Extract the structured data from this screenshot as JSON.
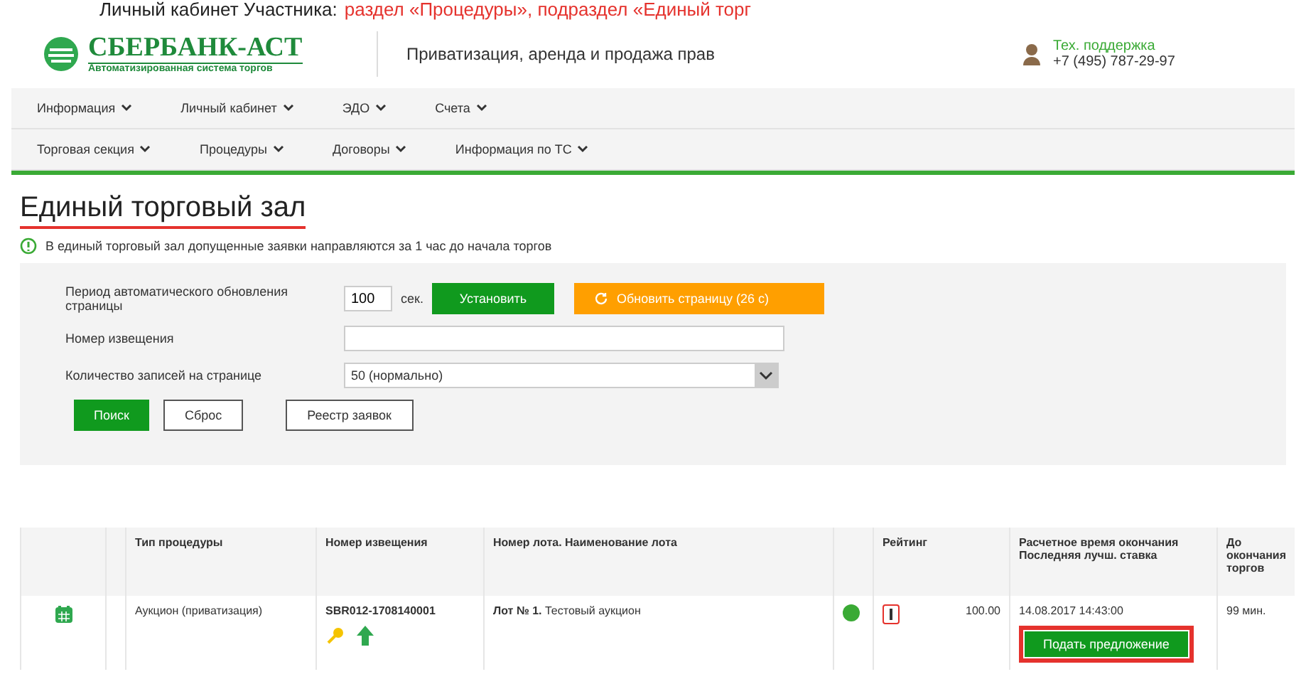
{
  "caption": {
    "prefix": "Личный кабинет Участника:",
    "highlight": "раздел «Процедуры», подраздел «Единый торг"
  },
  "header": {
    "logo_title": "СБЕРБАНК-АСТ",
    "logo_subtitle": "Автоматизированная система торгов",
    "tagline": "Приватизация, аренда и продажа прав",
    "support_label": "Тех. поддержка",
    "support_phone": "+7 (495) 787-29-97"
  },
  "nav_rows": [
    [
      "Информация",
      "Личный кабинет",
      "ЭДО",
      "Счета"
    ],
    [
      "Торговая секция",
      "Процедуры",
      "Договоры",
      "Информация по ТС"
    ]
  ],
  "page_title": "Единый торговый зал",
  "notice": "В единый торговый зал допущенные заявки направляются за 1 час до начала торгов",
  "filters": {
    "refresh_label": "Период автоматического обновления страницы",
    "refresh_value": "100",
    "refresh_unit": "сек.",
    "set_button": "Установить",
    "reload_button": "Обновить страницу (26 с)",
    "notice_label": "Номер извещения",
    "page_size_label": "Количество записей на странице",
    "page_size_value": "50 (нормально)",
    "buttons": [
      "Поиск",
      "Сброс",
      "Реестр заявок"
    ]
  },
  "table": {
    "columns": [
      "",
      "",
      "Тип процедуры",
      "Номер извещения",
      "Номер лота. Наименование лота",
      "",
      "Рейтинг",
      "Расчетное время окончания Последняя лучш. ставка",
      "До окончания торгов"
    ],
    "rows": [
      {
        "type": "Аукцион (приватизация)",
        "notice": "SBR012-1708140001",
        "lot_bold": "Лот № 1.",
        "lot_name": "Тестовый аукцион",
        "color": "#3aaa35",
        "rating": "100.00",
        "end_time": "14.08.2017 14:43:00",
        "action": "Подать предложение",
        "action_highlighted": true,
        "remaining": "99 мин."
      }
    ]
  }
}
